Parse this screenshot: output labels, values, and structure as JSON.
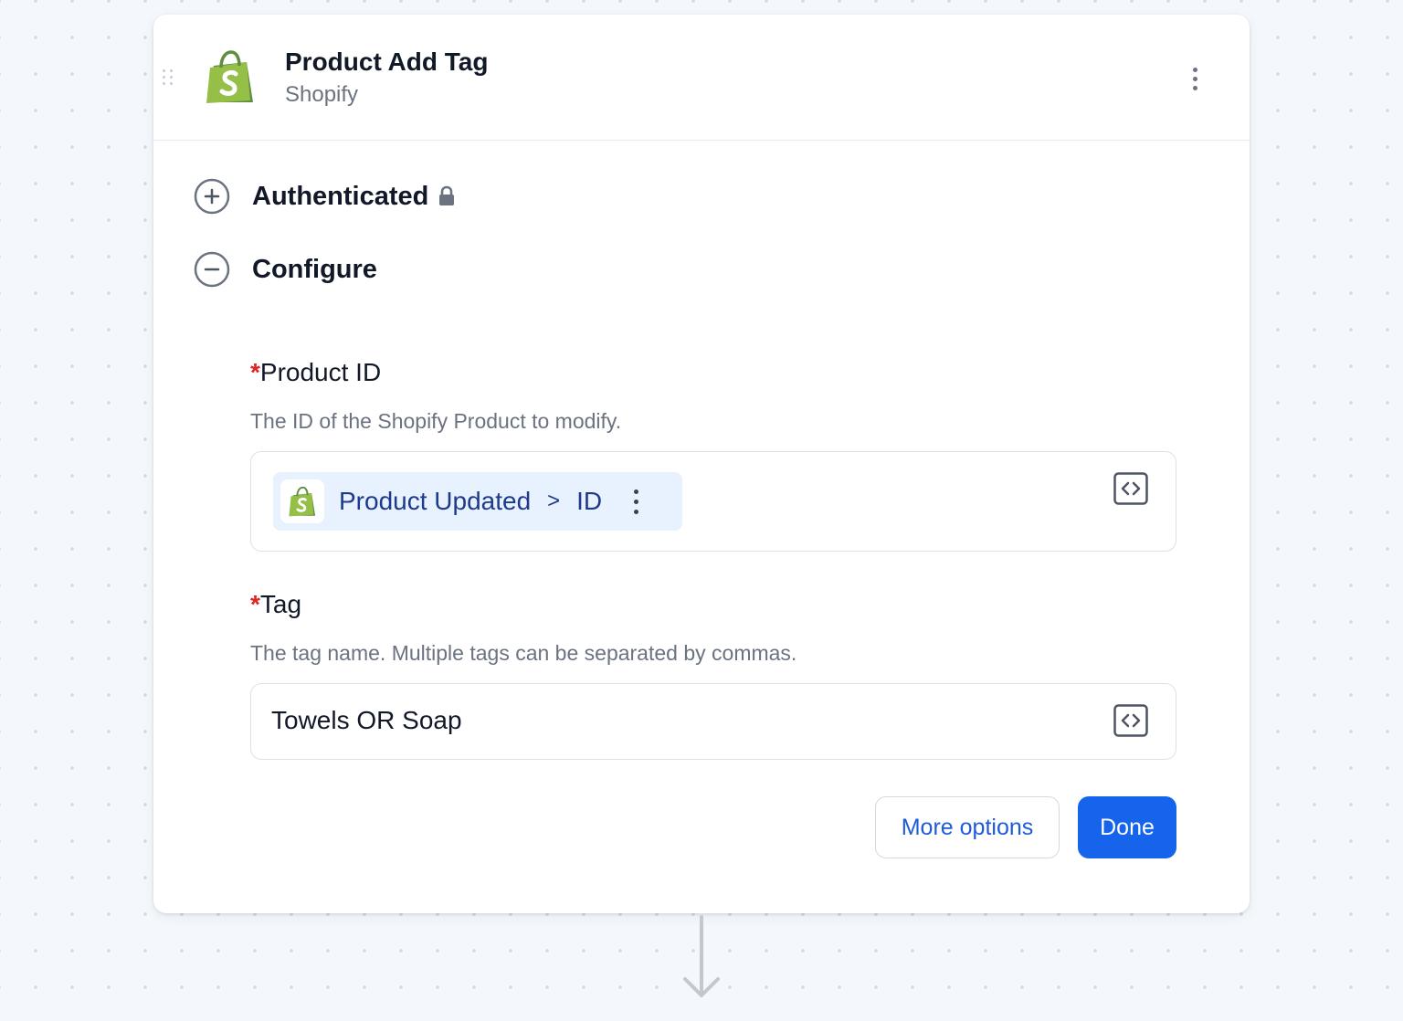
{
  "step": {
    "title": "Product Add Tag",
    "app_name": "Shopify"
  },
  "sections": {
    "authenticated_label": "Authenticated",
    "configure_label": "Configure"
  },
  "fields": {
    "product_id": {
      "required_marker": "*",
      "label": "Product ID",
      "help": "The ID of the Shopify Product to modify.",
      "chip_source": "Product Updated",
      "chip_separator": ">",
      "chip_field": "ID"
    },
    "tag": {
      "required_marker": "*",
      "label": "Tag",
      "help": "The tag name. Multiple tags can be separated by commas.",
      "value": "Towels OR Soap"
    }
  },
  "actions": {
    "more_options_label": "More options",
    "done_label": "Done"
  },
  "colors": {
    "primary": "#1664ec",
    "required": "#dc2626",
    "shopify_green": "#95bf47",
    "chip_bg": "#e8f1fe"
  },
  "icons": {
    "app_logo": "shopify-logo-icon",
    "expand": "plus-circle-icon",
    "collapse": "minus-circle-icon",
    "lock": "lock-icon",
    "code": "code-brackets-icon",
    "menu": "kebab-menu-icon",
    "flow": "arrow-down-icon"
  }
}
